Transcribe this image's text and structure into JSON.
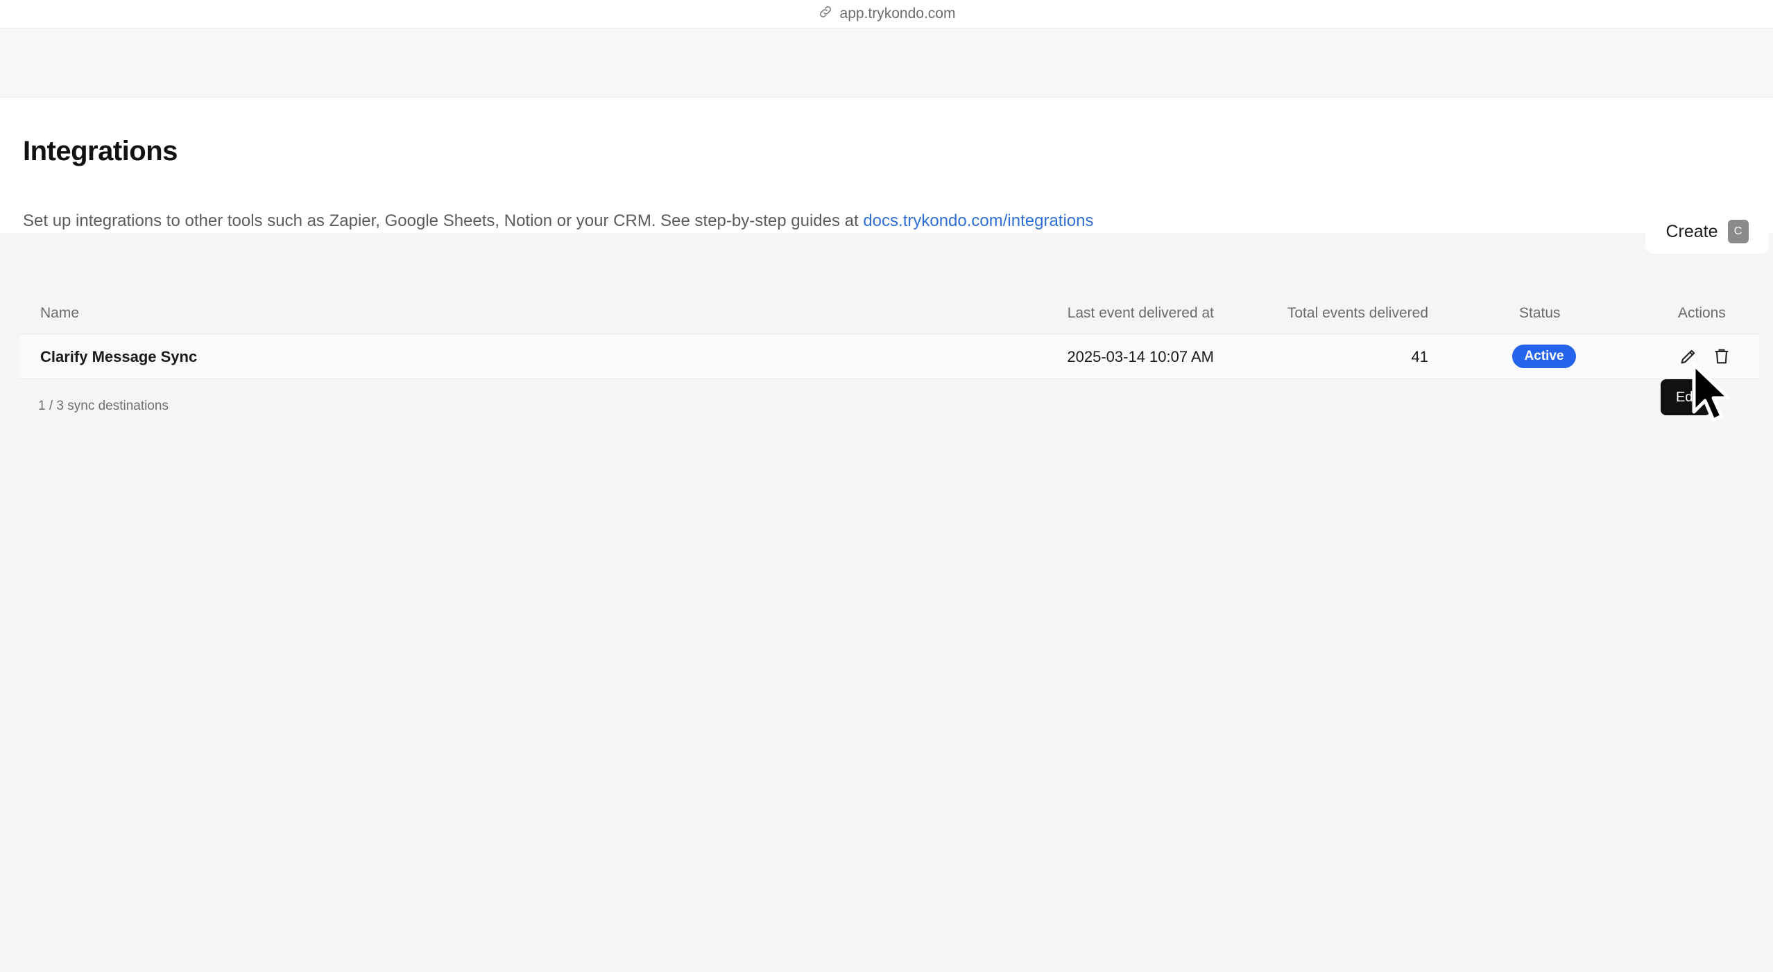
{
  "browser": {
    "url": "app.trykondo.com"
  },
  "page": {
    "title": "Integrations",
    "description_prefix": "Set up integrations to other tools such as Zapier, Google Sheets, Notion or your CRM. See step-by-step guides at ",
    "description_link": "docs.trykondo.com/integrations"
  },
  "create_button": {
    "label": "Create",
    "shortcut": "C"
  },
  "table": {
    "columns": {
      "name": "Name",
      "last_event": "Last event delivered at",
      "total_events": "Total events delivered",
      "status": "Status",
      "actions": "Actions"
    },
    "rows": [
      {
        "name": "Clarify Message Sync",
        "last_event": "2025-03-14 10:07 AM",
        "total_events": "41",
        "status": "Active"
      }
    ]
  },
  "footer": {
    "count_text": "1 / 3 sync destinations"
  },
  "tooltip": {
    "text": "Edit"
  },
  "colors": {
    "link": "#2f6fd6",
    "status_active": "#2563eb"
  },
  "icons": {
    "url": "link-icon",
    "edit": "pencil-icon",
    "delete": "trash-icon",
    "cursor": "mouse-cursor-icon"
  }
}
